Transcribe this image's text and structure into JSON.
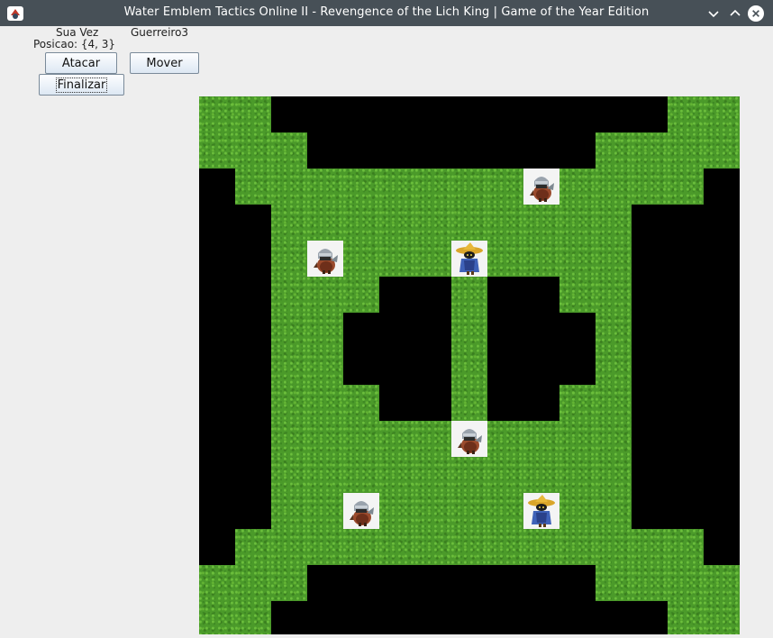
{
  "window": {
    "title": "Water Emblem Tactics Online II - Revengence of the Lich King | Game of the Year Edition",
    "icons": {
      "app": "java-app-icon",
      "minimize": "chevron-down-icon",
      "maximize": "chevron-up-icon",
      "close": "close-icon"
    }
  },
  "status": {
    "turn_label": "Sua Vez",
    "unit_name": "Guerreiro3",
    "position_label": "Posicao: {4, 3}"
  },
  "actions": {
    "attack_label": "Atacar",
    "move_label": "Mover",
    "finish_label": "Finalizar"
  },
  "map": {
    "cols": 15,
    "rows": 15,
    "legend": {
      "G": "grass",
      "W": "wall"
    },
    "grid": [
      "GGWWWWWWWWWWWGG",
      "GGGWWWWWWWWGGGG",
      "WGGGGGGGGGGGGGW",
      "WWGGGGGGGGGGWWW",
      "WWGGGGGGGGGGWWW",
      "WWGGGWWGWWGGWWW",
      "WWGGWWWGWWWGWWW",
      "WWGGWWWGWWWGWWW",
      "WWGGGWWGWWGGWWW",
      "WWGGGGGGGGGGWWW",
      "WWGGGGGGGGGGWWW",
      "WWGGGGGGGGGGWWW",
      "WGGGGGGGGGGGGGW",
      "GGGWWWWWWWWGGGG",
      "GGWWWWWWWWWWWGG"
    ],
    "units": [
      {
        "type": "warrior",
        "col": 9,
        "row": 2
      },
      {
        "type": "warrior",
        "col": 3,
        "row": 4
      },
      {
        "type": "mage",
        "col": 7,
        "row": 4
      },
      {
        "type": "warrior",
        "col": 7,
        "row": 9
      },
      {
        "type": "warrior",
        "col": 4,
        "row": 11
      },
      {
        "type": "mage",
        "col": 9,
        "row": 11
      }
    ]
  }
}
